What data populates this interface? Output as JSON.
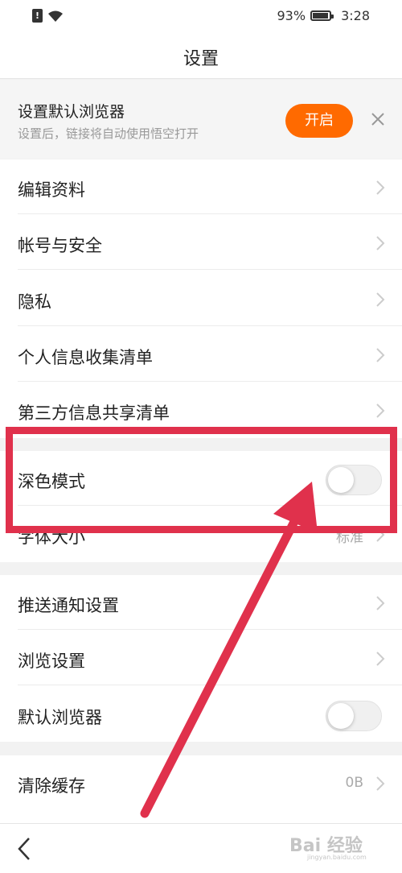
{
  "status_bar": {
    "sim_icon": "sim-alert-icon",
    "wifi_icon": "wifi-icon",
    "battery_percent": "93%",
    "battery_icon": "battery-icon",
    "time": "3:28"
  },
  "header": {
    "title": "设置"
  },
  "banner": {
    "title": "设置默认浏览器",
    "subtitle": "设置后，链接将自动使用悟空打开",
    "open_label": "开启",
    "close_icon": "close-icon"
  },
  "settings": {
    "edit_profile": "编辑资料",
    "account_security": "帐号与安全",
    "privacy": "隐私",
    "personal_info_list": "个人信息收集清单",
    "third_party_list": "第三方信息共享清单",
    "dark_mode": "深色模式",
    "dark_mode_on": false,
    "font_size": "字体大小",
    "font_size_value": "标准",
    "push_settings": "推送通知设置",
    "browse_settings": "浏览设置",
    "default_browser": "默认浏览器",
    "default_browser_on": false,
    "clear_cache": "清除缓存",
    "cache_size": "0B"
  },
  "bottom": {
    "back_icon": "back-arrow-icon"
  },
  "watermark": {
    "brand": "Bai 经验",
    "site": "jingyan.baidu.com"
  },
  "colors": {
    "accent": "#ff6a00",
    "annotation": "#e0314c",
    "background": "#f2f2f2"
  }
}
